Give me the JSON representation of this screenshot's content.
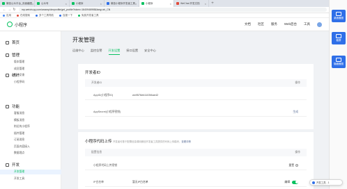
{
  "browser": {
    "tabs": [
      {
        "label": "微信公众平台_页面截图",
        "color": "#07c160"
      },
      {
        "label": "公众号",
        "color": "#07c160"
      },
      {
        "label": "小程序",
        "color": "#07c160"
      },
      {
        "label": "微信小程序开发者工具",
        "color": "#2f6fe8"
      },
      {
        "label": "小程序",
        "color": "#07c160"
      },
      {
        "label": "WeChat 开发文档",
        "color": "#e04a3a"
      }
    ],
    "url": "mp.weixin.qq.com/wxamp/devprofile/get_profile?token=1640946998&lang=zh_CN",
    "bookmarks": [
      "应用",
      "在线搜索",
      "多个工具导航",
      "百度一下",
      "免费开发者工具"
    ]
  },
  "right_toolbar": [
    {
      "label": "桌面截图",
      "color": "#2f6fe8"
    },
    {
      "label": "截屏",
      "color": "#2f6fe8"
    },
    {
      "label": "隐藏截图",
      "color": "#2f6fe8"
    }
  ],
  "header": {
    "app_name": "小程序",
    "nav": [
      "文档",
      "社区",
      "服务",
      "Web后台",
      "工具"
    ]
  },
  "sidebar": {
    "groups": [
      {
        "label": "首页",
        "icon": "home-icon"
      },
      {
        "label": "管理",
        "icon": "manage-icon",
        "items": [
          "版本管理",
          "成员管理",
          "用户反馈",
          "小程序码"
        ]
      },
      {
        "label": "统计",
        "icon": "chart-icon"
      },
      {
        "label": "功能",
        "icon": "function-icon",
        "items": [
          "客服消息",
          "模板消息",
          "附近的小程序",
          "插件管理",
          "订阅消息",
          "页面内容接入",
          "数据埋点"
        ]
      },
      {
        "label": "开发",
        "icon": "code-icon",
        "items": [
          "开发管理",
          "开发工具"
        ]
      }
    ]
  },
  "main": {
    "title": "开发管理",
    "tabs": [
      "运维中心",
      "监控告警",
      "开发设置",
      "接口设置",
      "安全中心"
    ],
    "active_tab": "开发设置",
    "developer_id": {
      "title": "开发者ID",
      "header_left": "开发者ID",
      "header_right": "操作",
      "rows": [
        {
          "label": "AppID(小程序ID)",
          "value": "wx9576eb1103f4ae42",
          "action": ""
        },
        {
          "label": "AppSecret(小程序密钥)",
          "value": "",
          "action": "生成"
        }
      ]
    },
    "upload": {
      "title": "小程序代码上传",
      "desc": "开发者可基于配置信息调用微信开发者工具提供的代码上传模块，",
      "desc_link": "查看详情",
      "header_left": "配置信息",
      "header_right": "操作",
      "rows": [
        {
          "label": "小程序代码上传密钥",
          "action": "重置"
        },
        {
          "label": "IP白名单",
          "value": "暂无IP白名单",
          "action": "编辑"
        }
      ]
    }
  },
  "pill": {
    "label": "开发工具 - 1"
  },
  "colors": {
    "accent": "#07c160",
    "primary": "#2f6fe8",
    "link": "#576b95"
  }
}
